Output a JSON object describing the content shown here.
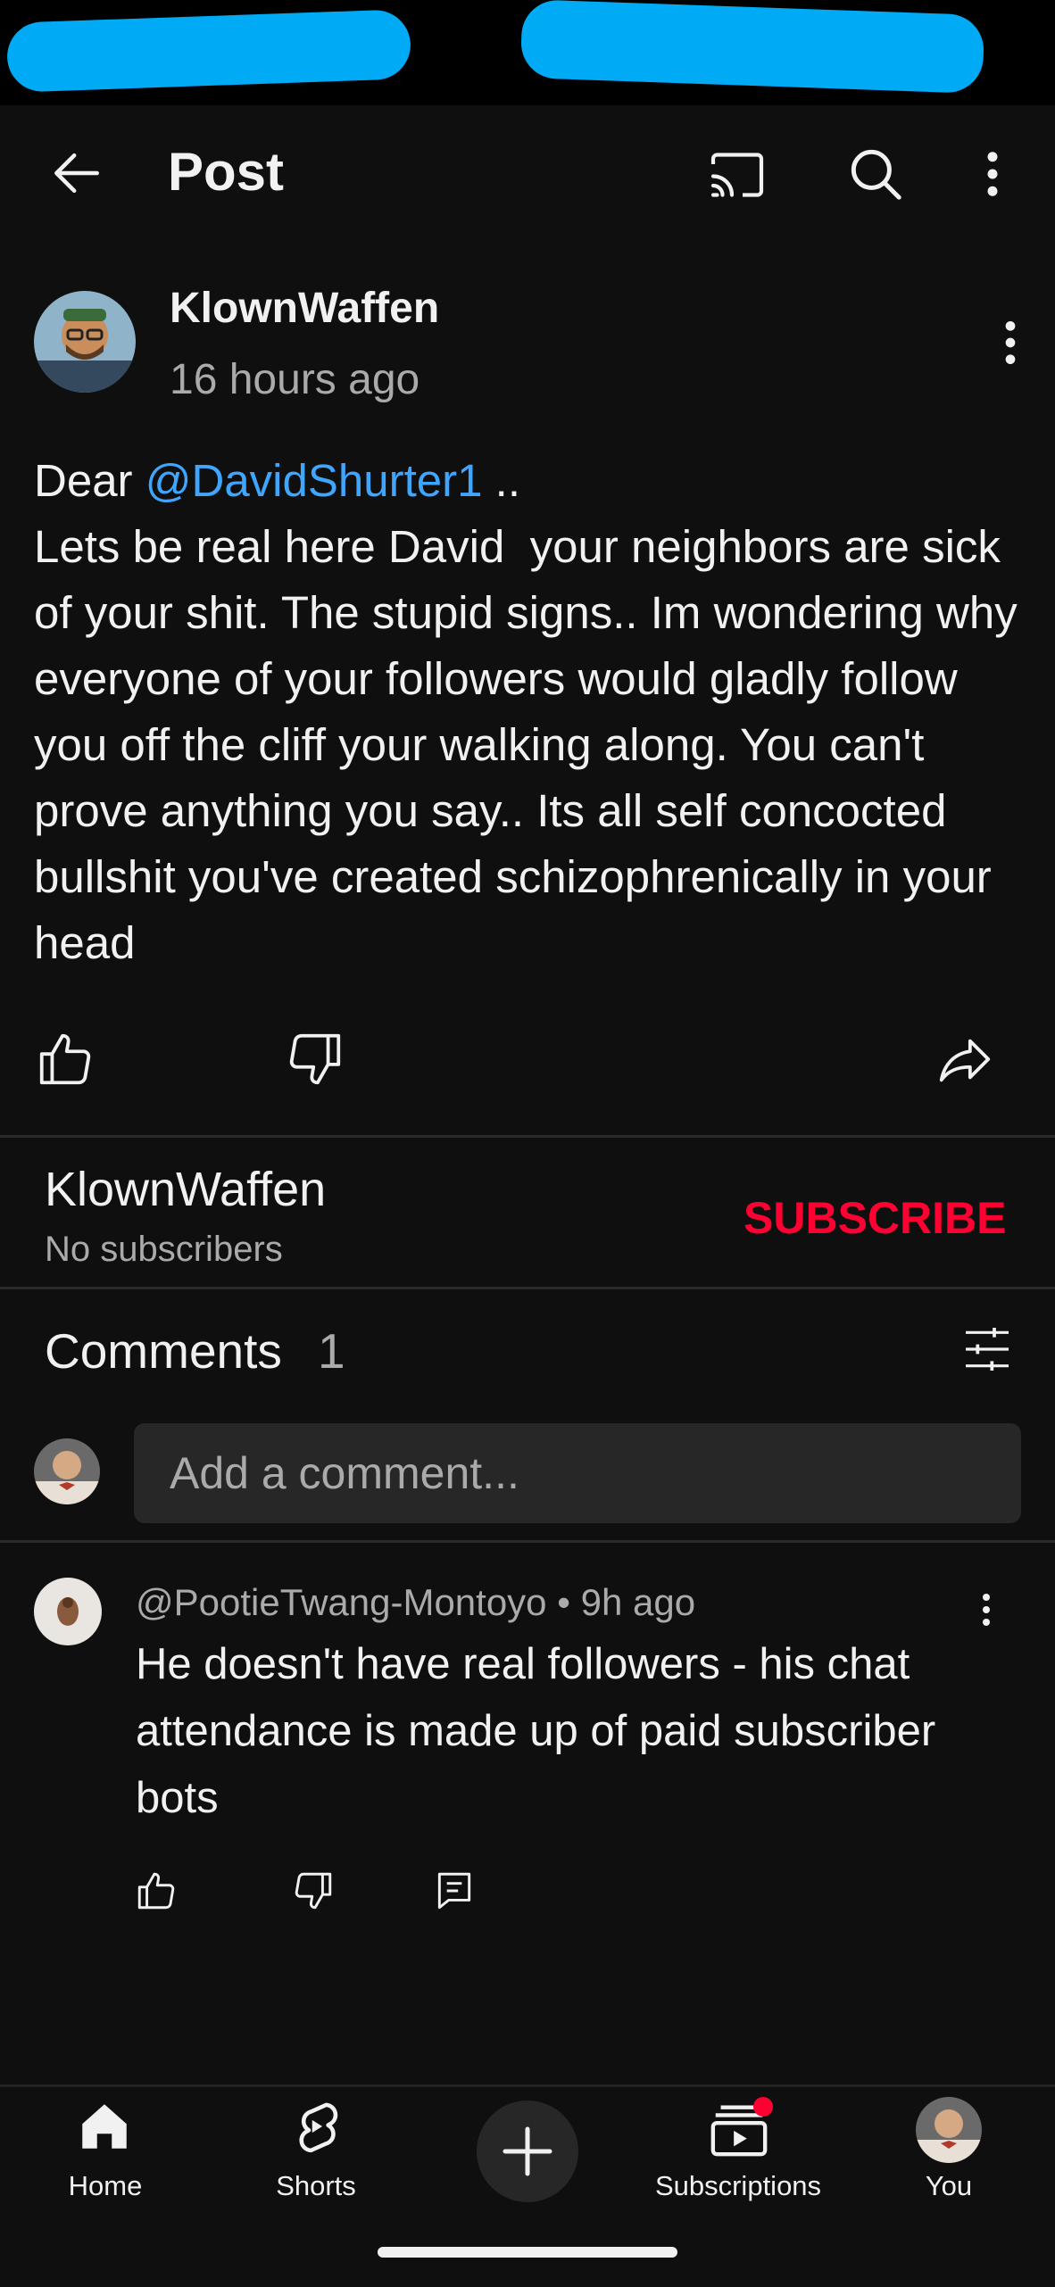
{
  "header": {
    "title": "Post"
  },
  "post": {
    "author": "KlownWaffen",
    "time": "16 hours ago",
    "greeting": "Dear ",
    "mention": "@DavidShurter1",
    "greeting_suffix": " ..",
    "body": "Lets be real here David  your neighbors are sick of your shit. The stupid signs.. Im wondering why everyone of your followers would gladly follow you off the cliff your walking along. You can't prove anything you say.. Its all self concocted bullshit you've created schizophrenically in your head"
  },
  "channel": {
    "name": "KlownWaffen",
    "subscribers": "No subscribers",
    "subscribe_label": "SUBSCRIBE"
  },
  "comments": {
    "title": "Comments",
    "count": "1",
    "placeholder": "Add a comment...",
    "items": [
      {
        "meta": "@PootieTwang-Montoyo • 9h ago",
        "text": "He doesn't have real followers - his chat attendance is made up of paid subscriber bots"
      }
    ]
  },
  "bottom_nav": {
    "items": [
      {
        "label": "Home",
        "icon": "home-icon"
      },
      {
        "label": "Shorts",
        "icon": "shorts-icon"
      },
      {
        "label": "",
        "icon": "create-plus-icon"
      },
      {
        "label": "Subscriptions",
        "icon": "subscriptions-icon"
      },
      {
        "label": "You",
        "icon": "you-avatar"
      }
    ]
  },
  "colors": {
    "background": "#0f0f0f",
    "accent_link": "#3ea6ff",
    "subscribe_red": "#ff0033",
    "redaction_blue": "#00aaf5",
    "notification_dot": "#ff0033"
  }
}
